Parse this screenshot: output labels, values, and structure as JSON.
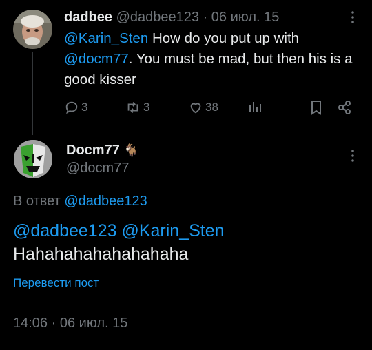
{
  "parent_tweet": {
    "name": "dadbee",
    "handle": "@dadbee123",
    "separator": " · ",
    "date": "06 июл. 15",
    "mention1": "@Karin_Sten",
    "text1": " How do you put up with ",
    "mention2": "@docm77",
    "text2": ". You must be mad, but then his is a good kisser",
    "replies": "3",
    "retweets": "3",
    "likes": "38",
    "icons": [
      "reply-icon",
      "retweet-icon",
      "like-icon",
      "views-icon",
      "bookmark-icon",
      "share-icon",
      "more-icon"
    ]
  },
  "main_tweet": {
    "name": "Docm77",
    "emoji": "🐐",
    "handle": "@docm77",
    "reply_prefix": "В ответ ",
    "reply_to": "@dadbee123",
    "mention1": "@dadbee123",
    "mention2": "@Karin_Sten",
    "body": "Hahahahahahahahaha",
    "translate_label": "Перевести пост",
    "time": "14:06",
    "date_separator": " · ",
    "date": "06 июл. 15"
  },
  "colors": {
    "background": "#000000",
    "text": "#e7e9ea",
    "muted": "#71767b",
    "link": "#1d9bf0"
  }
}
